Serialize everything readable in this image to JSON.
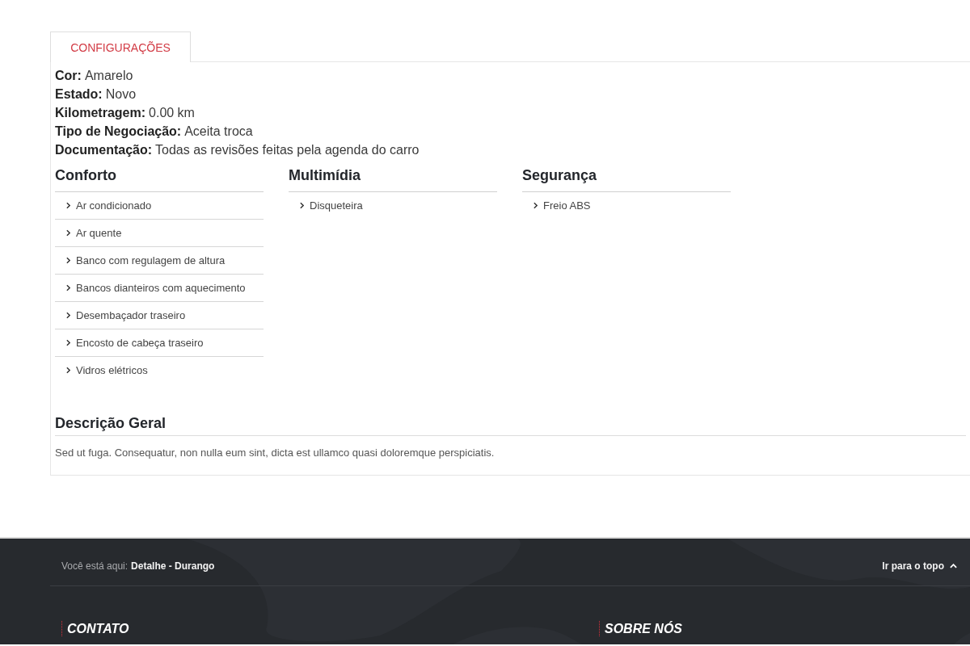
{
  "tabs": [
    {
      "label": "CONFIGURAÇÕES",
      "selected": true
    }
  ],
  "specs": [
    {
      "label": "Cor:",
      "value": "Amarelo"
    },
    {
      "label": "Estado:",
      "value": "Novo"
    },
    {
      "label": "Kilometragem:",
      "value": "0.00 km"
    },
    {
      "label": "Tipo de Negociação:",
      "value": "Aceita troca"
    },
    {
      "label": "Documentação:",
      "value": "Todas as revisões feitas pela agenda do carro"
    }
  ],
  "feature_groups": [
    {
      "title": "Conforto",
      "items": [
        "Ar condicionado",
        "Ar quente",
        "Banco com regulagem de altura",
        "Bancos dianteiros com aquecimento",
        "Desembaçador traseiro",
        "Encosto de cabeça traseiro",
        "Vidros elétricos"
      ]
    },
    {
      "title": "Multimídia",
      "items": [
        "Disqueteira"
      ]
    },
    {
      "title": "Segurança",
      "items": [
        "Freio ABS"
      ]
    }
  ],
  "description": {
    "title": "Descrição Geral",
    "text": "Sed ut fuga. Consequatur, non nulla eum sint, dicta est ullamco quasi doloremque perspiciatis."
  },
  "footer": {
    "breadcrumb": {
      "label": "Você está aqui:",
      "current": "Detalhe - Durango"
    },
    "back_to_top": "Ir para o topo",
    "headings": [
      "CONTATO",
      "SOBRE NÓS"
    ]
  }
}
